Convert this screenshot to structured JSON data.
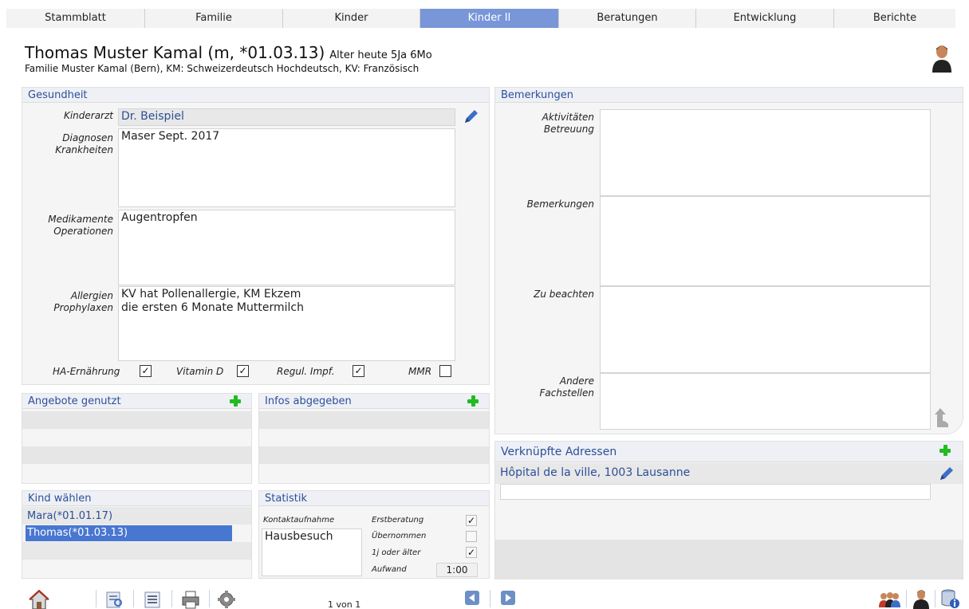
{
  "tabs": [
    {
      "label": "Stammblatt",
      "active": false
    },
    {
      "label": "Familie",
      "active": false
    },
    {
      "label": "Kinder",
      "active": false
    },
    {
      "label": "Kinder II",
      "active": true
    },
    {
      "label": "Beratungen",
      "active": false
    },
    {
      "label": "Entwicklung",
      "active": false
    },
    {
      "label": "Berichte",
      "active": false
    }
  ],
  "header": {
    "title": "Thomas Muster Kamal (m, *01.03.13)",
    "age": "Alter heute 5Ja 6Mo",
    "subtitle": "Familie Muster Kamal (Bern), KM: Schweizerdeutsch Hochdeutsch, KV: Französisch"
  },
  "gesundheit": {
    "title": "Gesundheit",
    "kinderarzt_label": "Kinderarzt",
    "kinderarzt_value": "Dr. Beispiel",
    "diagnosen_label": "Diagnosen\nKrankheiten",
    "diagnosen_value": "Maser Sept. 2017",
    "medikamente_label": "Medikamente\nOperationen",
    "medikamente_value": "Augentropfen",
    "allergien_label": "Allergien\nProphylaxen",
    "allergien_value": "KV hat Pollenallergie, KM Ekzem\ndie ersten 6 Monate Muttermilch",
    "checks": [
      {
        "label": "HA-Ernährung",
        "checked": true,
        "mark": "✓"
      },
      {
        "label": "Vitamin D",
        "checked": true,
        "mark": "✓"
      },
      {
        "label": "Regul. Impf.",
        "checked": true,
        "mark": "✓"
      },
      {
        "label": "MMR",
        "checked": false,
        "mark": ""
      }
    ]
  },
  "angebote": {
    "title": "Angebote genutzt"
  },
  "infos": {
    "title": "Infos abgegeben"
  },
  "kind_waehlen": {
    "title": "Kind wählen",
    "items": [
      {
        "label": "Mara(*01.01.17)",
        "selected": false
      },
      {
        "label": "Thomas(*01.03.13)",
        "selected": true
      }
    ]
  },
  "statistik": {
    "title": "Statistik",
    "kontakt_label": "Kontaktaufnahme",
    "kontakt_value": "Hausbesuch",
    "erstberatung_label": "Erstberatung",
    "erstberatung_mark": "✓",
    "uebernommen_label": "Übernommen",
    "uebernommen_mark": "",
    "alter_label": "1j oder älter",
    "alter_mark": "✓",
    "aufwand_label": "Aufwand",
    "aufwand_value": "1:00"
  },
  "bemerkungen": {
    "title": "Bemerkungen",
    "aktivitaeten_label": "Aktivitäten\nBetreuung",
    "bemerkungen_label": "Bemerkungen",
    "zu_beachten_label": "Zu beachten",
    "andere_label": "Andere\nFachstellen"
  },
  "verknuepfte": {
    "title": "Verknüpfte Adressen",
    "item": "Hôpital de la ville, 1003 Lausanne"
  },
  "footer": {
    "page_indicator": "1 von 1"
  },
  "colors": {
    "accent": "#4877d1",
    "tab_active": "#7896d8",
    "header_text": "#2c4f99",
    "plus": "#22bb22"
  }
}
